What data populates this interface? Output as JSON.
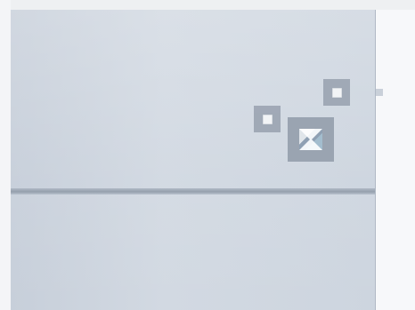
{
  "window": {
    "title": ""
  },
  "icons": {
    "dock_small_top_right": "dock-tab-icon",
    "dock_small_left": "dock-tab-icon",
    "dock_center": "dock-center-icon"
  },
  "colors": {
    "background": "#eceef1",
    "panel": "#cdd5df",
    "splitter": "#909ba8",
    "dock_icon": "#9aa4b1",
    "dock_highlight": "#76c8f0"
  }
}
